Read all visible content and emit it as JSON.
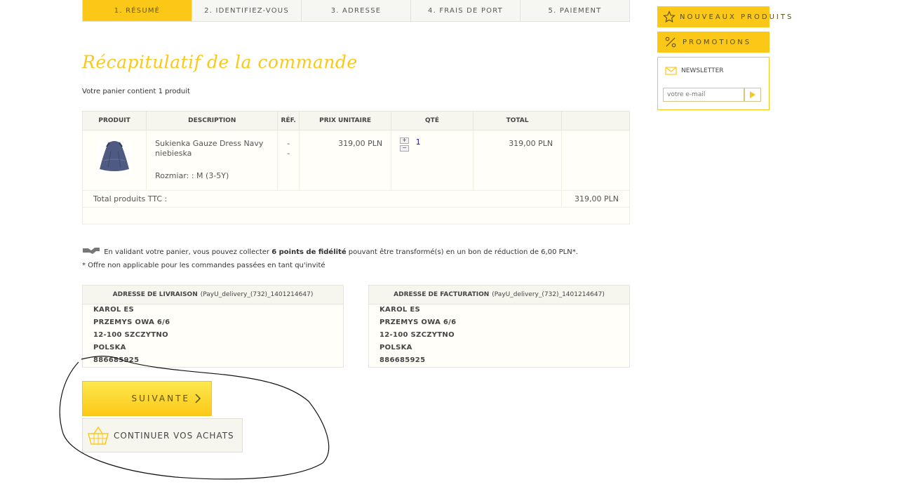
{
  "steps": [
    "1. Résumé",
    "2. Identifiez-vous",
    "3. Adresse",
    "4. Frais de port",
    "5. Paiement"
  ],
  "sidebar": {
    "new_products": "NOUVEAUX PRODUITS",
    "promotions": "PROMOTIONS",
    "newsletter_title": "NEWSLETTER",
    "newsletter_placeholder": "votre e-mail"
  },
  "main": {
    "title": "Récapitulatif de la commande",
    "cart_count": "Votre panier contient 1 produit"
  },
  "cart": {
    "headers": [
      "Produit",
      "Description",
      "Réf.",
      "Prix unitaire",
      "Qté",
      "Total",
      ""
    ],
    "row": {
      "name": "Sukienka Gauze Dress Navy niebieska",
      "attr": "Rozmiar: : M (3-5Y)",
      "ref1": "-",
      "ref2": "-",
      "unit_price": "319,00 PLN",
      "qty": "1",
      "total": "319,00 PLN"
    },
    "total_label": "Total produits TTC :",
    "total_value": "319,00 PLN"
  },
  "loyalty": {
    "text_before": "En validant votre panier, vous pouvez collecter ",
    "points": "6 points de fidélité",
    "text_after": " pouvant être transformé(s) en un bon de réduction de 6,00 PLN*.",
    "note": "* Offre non applicable pour les commandes passées en tant qu'invité"
  },
  "delivery": {
    "title": "Adresse de livraison",
    "alias": "(PayU_delivery_(732)_1401214647)",
    "lines": [
      "KAROL ES",
      "PRZEMYS OWA 6/6",
      "12-100 SZCZYTNO",
      "POLSKA",
      "886685925"
    ]
  },
  "invoice": {
    "title": "Adresse de facturation",
    "alias": "(PayU_delivery_(732)_1401214647)",
    "lines": [
      "KAROL ES",
      "PRZEMYS OWA 6/6",
      "12-100 SZCZYTNO",
      "POLSKA",
      "886685925"
    ]
  },
  "buttons": {
    "next": "SUIVANTE",
    "continue": "CONTINUER VOS ACHATS"
  },
  "colors": {
    "accent": "#fcc817",
    "link": "#1a0dab"
  }
}
